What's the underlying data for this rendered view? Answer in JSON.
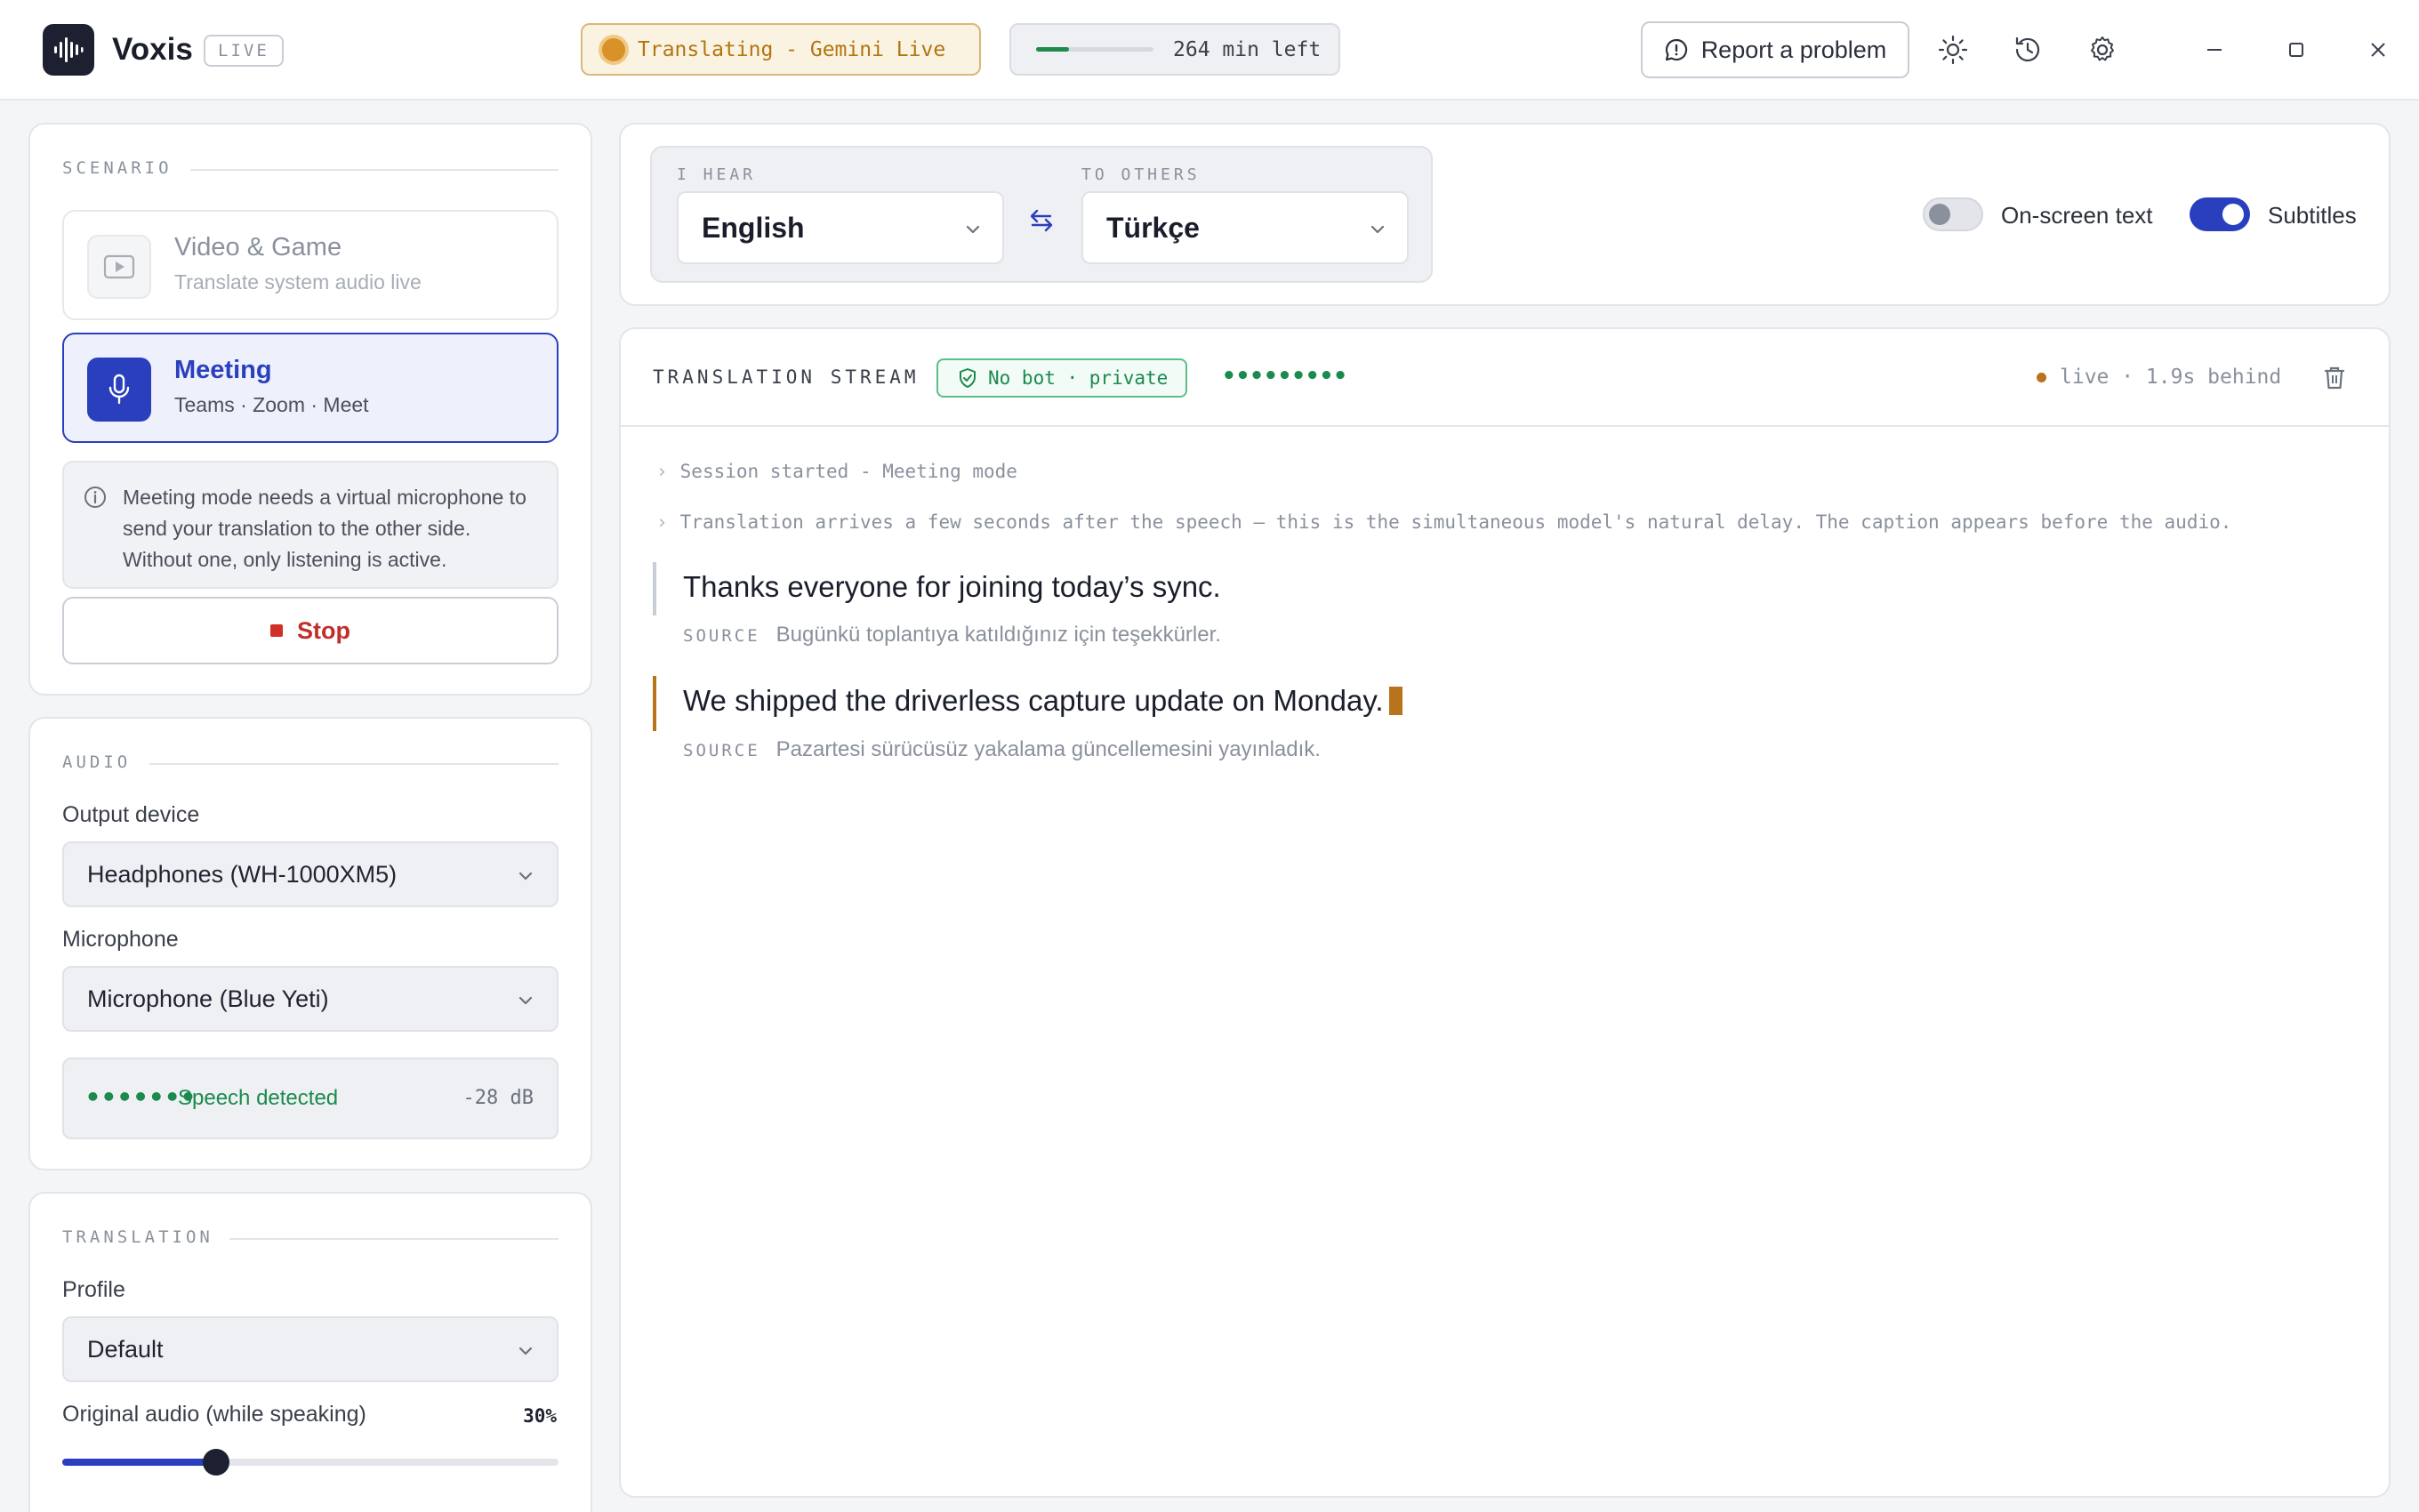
{
  "app": {
    "name": "Voxis",
    "badge": "LIVE",
    "status": "Translating - Gemini Live",
    "minutes_left": "264 min left",
    "minutes_fraction": 0.28,
    "report_label": "Report a problem"
  },
  "scenario": {
    "section": "SCENARIO",
    "options": [
      {
        "title": "Video & Game",
        "subtitle": "Translate system audio live",
        "selected": false
      },
      {
        "title": "Meeting",
        "subtitle": "Teams · Zoom · Meet",
        "selected": true
      }
    ],
    "info": "Meeting mode needs a virtual microphone to send your translation to the other side. Without one, only listening is active.",
    "stop_label": "Stop"
  },
  "audio": {
    "section": "AUDIO",
    "output_label": "Output device",
    "output_value": "Headphones (WH-1000XM5)",
    "mic_label": "Microphone",
    "mic_value": "Microphone (Blue Yeti)",
    "level_dots": "•••••••",
    "speech_status": "Speech detected",
    "db": "-28 dB"
  },
  "translation": {
    "section": "TRANSLATION",
    "profile_label": "Profile",
    "profile_value": "Default",
    "original_audio_label": "Original audio (while speaking)",
    "original_audio_value": "30%",
    "original_audio_fraction": 0.31
  },
  "languages": {
    "hear_label": "I HEAR",
    "hear_value": "English",
    "others_label": "TO OTHERS",
    "others_value": "Türkçe",
    "onscreen_label": "On-screen text",
    "onscreen_on": false,
    "subtitles_label": "Subtitles",
    "subtitles_on": true
  },
  "stream": {
    "title": "TRANSLATION STREAM",
    "privacy": "No bot · private",
    "activity_dots": "•••••••••",
    "live_status": "live · 1.9s behind",
    "system_lines": [
      "Session started - Meeting mode",
      "Translation arrives a few seconds after the speech — this is the simultaneous model's natural delay. The caption appears before the audio."
    ],
    "source_tag": "SOURCE",
    "entries": [
      {
        "text": "Thanks everyone for joining today’s sync.",
        "source": "Bugünkü toplantıya katıldığınız için teşekkürler."
      },
      {
        "text": "We shipped the driverless capture update on Monday.",
        "source": "Pazartesi sürücüsüz yakalama güncellemesini yayınladık."
      }
    ]
  },
  "colors": {
    "accent": "#2a3fbd",
    "live": "#b8741c",
    "ok": "#1b8a4d",
    "danger": "#c0302a"
  }
}
